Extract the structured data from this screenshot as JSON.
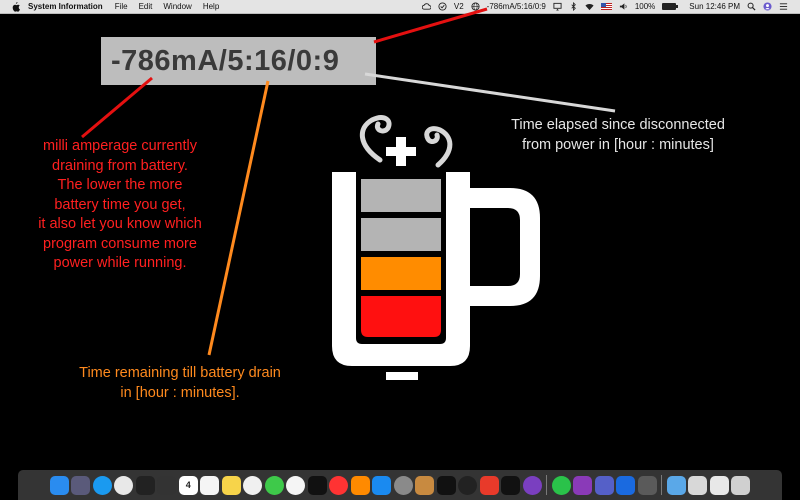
{
  "menubar": {
    "app_name": "System Information",
    "menus": [
      "File",
      "Edit",
      "Window",
      "Help"
    ],
    "status_readout": "-786mA/5:16/0:9",
    "battery_percent": "100%",
    "battery_level": 1.0,
    "clock": "Sun 12:46 PM",
    "status_icons": [
      "cloud-icon",
      "check-circle-icon",
      "v2-icon",
      "globe-icon",
      "screen-mirror-icon",
      "bluetooth-icon",
      "wifi-icon",
      "flag-us-icon",
      "volume-icon",
      "battery-icon",
      "search-icon",
      "user-icon",
      "notification-center-icon"
    ],
    "v2_label": "V2"
  },
  "readout": {
    "text": "-786mA/5:16/0:9"
  },
  "annotations": {
    "milliamp_lines": [
      "milli amperage currently",
      "draining from battery.",
      "The lower the more",
      "battery time you get,",
      "it also let you know which",
      "program consume more",
      "power while running."
    ],
    "elapsed_lines": [
      "Time elapsed since disconnected",
      "from power in [hour : minutes]"
    ],
    "remaining_lines": [
      "Time remaining till battery drain",
      "in [hour : minutes]."
    ]
  },
  "colors": {
    "annotation_red": "#ff2020",
    "annotation_white": "#e6e6e6",
    "annotation_orange": "#ff8a1e",
    "cup_gray": "#b4b4b4",
    "cup_orange": "#ff8c00",
    "cup_red": "#ff1010"
  },
  "dock": {
    "calendar_day": "4",
    "items": [
      {
        "name": "finder-icon",
        "color": "#2a8cf0"
      },
      {
        "name": "launchpad-icon",
        "color": "#5a5a7a"
      },
      {
        "name": "safari-icon",
        "color": "#1a9af0"
      },
      {
        "name": "chrome-icon",
        "color": "#e8e8e8"
      },
      {
        "name": "activity-monitor-icon",
        "color": "#222"
      },
      {
        "name": "istat-icon",
        "color": "#333"
      },
      {
        "name": "calendar-icon",
        "color": "#fff"
      },
      {
        "name": "reminders-icon",
        "color": "#f5f5f5"
      },
      {
        "name": "notes-icon",
        "color": "#f7d44a"
      },
      {
        "name": "photos-icon",
        "color": "#f0f0f0"
      },
      {
        "name": "messages-icon",
        "color": "#3ec94a"
      },
      {
        "name": "itunes-icon",
        "color": "#f5f5f5"
      },
      {
        "name": "apple-tv-icon",
        "color": "#111"
      },
      {
        "name": "news-icon",
        "color": "#f33"
      },
      {
        "name": "ibooks-icon",
        "color": "#ff8a00"
      },
      {
        "name": "app-store-icon",
        "color": "#1a8af0"
      },
      {
        "name": "system-preferences-icon",
        "color": "#8a8a8a"
      },
      {
        "name": "preview-icon",
        "color": "#c88a40"
      },
      {
        "name": "terminal-icon",
        "color": "#111"
      },
      {
        "name": "speed-test-icon",
        "color": "#222"
      },
      {
        "name": "teamviewer-icon",
        "color": "#e83a2a"
      },
      {
        "name": "battery-app-icon",
        "color": "#111"
      },
      {
        "name": "github-icon",
        "color": "#7a3fc0"
      },
      {
        "name": "whatsapp-icon",
        "color": "#2ac24a"
      },
      {
        "name": "onenote-icon",
        "color": "#8a3ab8"
      },
      {
        "name": "teams-icon",
        "color": "#5560c8"
      },
      {
        "name": "xcode-icon",
        "color": "#1a6ae0"
      },
      {
        "name": "automator-icon",
        "color": "#5a5a5a"
      },
      {
        "name": "downloads-folder-icon",
        "color": "#5aa8e8"
      },
      {
        "name": "screenshot-folder-icon",
        "color": "#d8d8d8"
      },
      {
        "name": "documents-stack-icon",
        "color": "#e8e8e8"
      },
      {
        "name": "trash-icon",
        "color": "#d0d0d0"
      }
    ]
  }
}
